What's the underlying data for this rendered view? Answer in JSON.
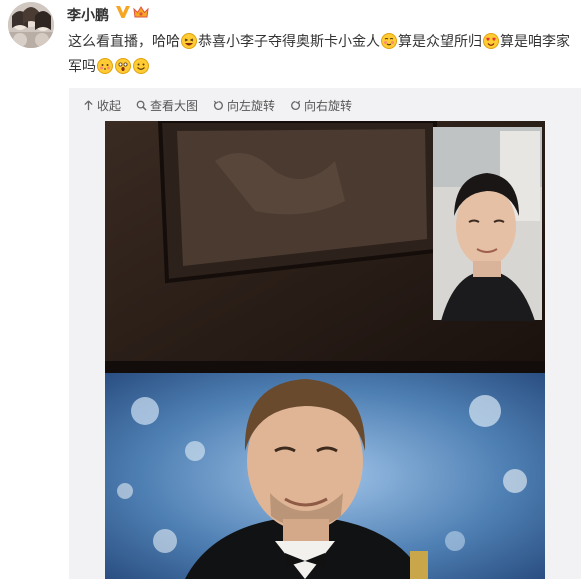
{
  "user": {
    "name": "李小鹏",
    "verified_badge": "verified-v-icon",
    "vip_badge": "vip-crown-icon",
    "badge_color": "#f5a623"
  },
  "post": {
    "segments": [
      {
        "type": "text",
        "value": "这么看直播，哈哈"
      },
      {
        "type": "emoji",
        "name": "laughing-emoji-icon"
      },
      {
        "type": "text",
        "value": "恭喜小李子夺得奥斯卡小金人"
      },
      {
        "type": "emoji",
        "name": "blush-emoji-icon"
      },
      {
        "type": "text",
        "value": "算是众望所归"
      },
      {
        "type": "emoji",
        "name": "heart-eyes-emoji-icon"
      },
      {
        "type": "text",
        "value": "算是咱李家军吗"
      },
      {
        "type": "emoji",
        "name": "shy-emoji-icon"
      },
      {
        "type": "emoji",
        "name": "surprised-emoji-icon"
      },
      {
        "type": "emoji",
        "name": "smile-emoji-icon"
      }
    ]
  },
  "toolbar": {
    "collapse_label": "收起",
    "view_large_label": "查看大图",
    "rotate_left_label": "向左旋转",
    "rotate_right_label": "向右旋转"
  }
}
